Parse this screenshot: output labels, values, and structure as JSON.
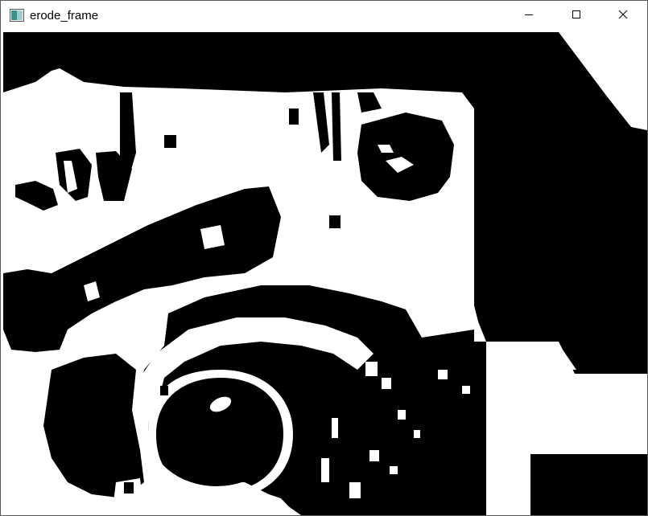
{
  "window": {
    "title": "erode_frame",
    "icon": "app-image-icon",
    "controls": {
      "minimize": "minimize-icon",
      "maximize": "maximize-icon",
      "close": "close-icon"
    }
  },
  "image": {
    "description_type": "binary eroded frame",
    "foreground_color": "#000000",
    "background_color": "#ffffff"
  }
}
